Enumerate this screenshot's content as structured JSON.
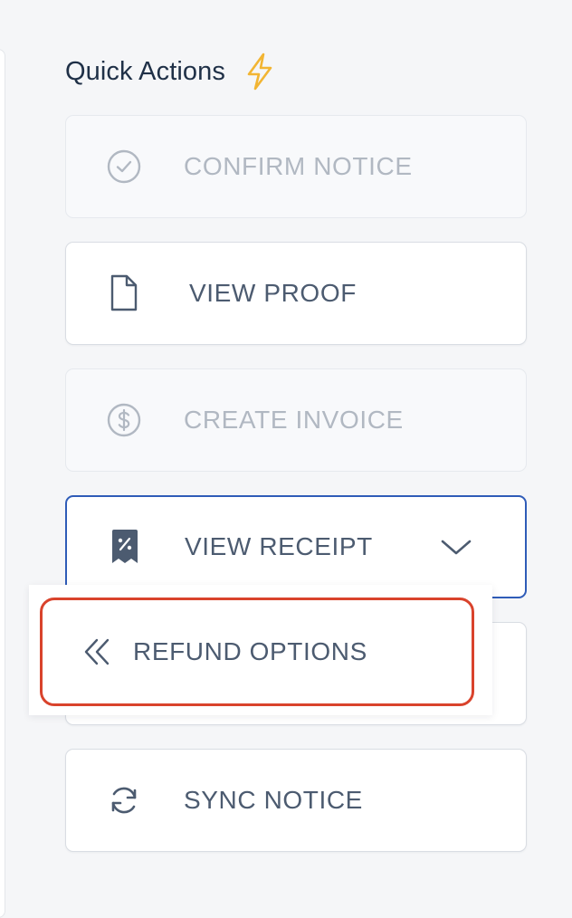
{
  "section": {
    "title": "Quick Actions",
    "title_icon": "lightning-bolt-icon"
  },
  "actions": [
    {
      "label": "CONFIRM NOTICE",
      "icon": "check-circle-icon",
      "state": "disabled"
    },
    {
      "label": "VIEW PROOF",
      "icon": "document-icon",
      "state": "enabled"
    },
    {
      "label": "CREATE INVOICE",
      "icon": "dollar-circle-icon",
      "state": "disabled"
    },
    {
      "label": "VIEW RECEIPT",
      "icon": "receipt-percent-icon",
      "state": "active",
      "expanded": true,
      "trailing_icon": "chevron-down-icon"
    },
    {
      "label": "",
      "icon": "",
      "state": "enabled",
      "note": "hidden behind dropdown"
    },
    {
      "label": "SYNC NOTICE",
      "icon": "refresh-icon",
      "state": "enabled"
    }
  ],
  "dropdown": {
    "items": [
      {
        "label": "REFUND OPTIONS",
        "icon": "double-chevron-left-icon",
        "highlighted": true
      }
    ]
  },
  "colors": {
    "active_border": "#2f5cb8",
    "highlight_border": "#d9432c",
    "bolt": "#f2b533",
    "text": "#4c5b70",
    "disabled_text": "#b1b8c2"
  }
}
